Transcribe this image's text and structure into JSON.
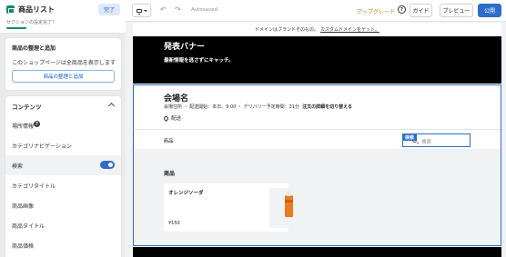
{
  "app": {
    "title": "商品リスト",
    "done_label": "完了",
    "section_note": "セクションの設定完了?"
  },
  "organize_card": {
    "title": "商品の整理と追加",
    "description": "このショップページは全商品を表示します",
    "button_label": "商品の整理と追加"
  },
  "content_section": {
    "title": "コンテンツ",
    "items": [
      {
        "label": "場所情報",
        "icon": "help-icon"
      },
      {
        "label": "カテゴリナビゲーション"
      },
      {
        "label": "検索",
        "toggle": true,
        "toggle_on": true
      },
      {
        "label": "カテゴリタイトル"
      },
      {
        "label": "商品画像"
      },
      {
        "label": "商品タイトル"
      },
      {
        "label": "商品価格"
      }
    ]
  },
  "topbar": {
    "device_icon": "monitor-icon",
    "undo_icon": "undo-icon",
    "redo_icon": "redo-icon",
    "undo_glyph": "↶",
    "redo_glyph": "↷",
    "autosaved": "Autosaved",
    "upgrade": "アップグレード",
    "help_glyph": "?",
    "guide": "ガイド",
    "preview": "プレビュー",
    "publish": "公開"
  },
  "preview": {
    "notice_text": "ドメインはブランドそのもの。",
    "notice_link": "カスタムドメインをゲット。",
    "banner_title": "発表バナー",
    "banner_subtitle": "最新情報を逃さずにキャッチ。",
    "venue_name": "会場名",
    "venue_meta": "会場住所 ・ 配送開始：本日、9:00 ・ デリバリー予定時間：31分",
    "venue_meta_link": "注文の詳細を切り替える",
    "delivery_label": "配送",
    "products_bar_label": "商品",
    "search_tag": "検索",
    "search_placeholder": "検索",
    "grid_title": "商品",
    "product": {
      "name": "オレンジソーダ",
      "price": "¥150"
    }
  },
  "colors": {
    "accent": "#2c6ecb",
    "brand_green": "#0f8a6f",
    "upgrade": "#b98900",
    "banner_bg": "#000000"
  }
}
